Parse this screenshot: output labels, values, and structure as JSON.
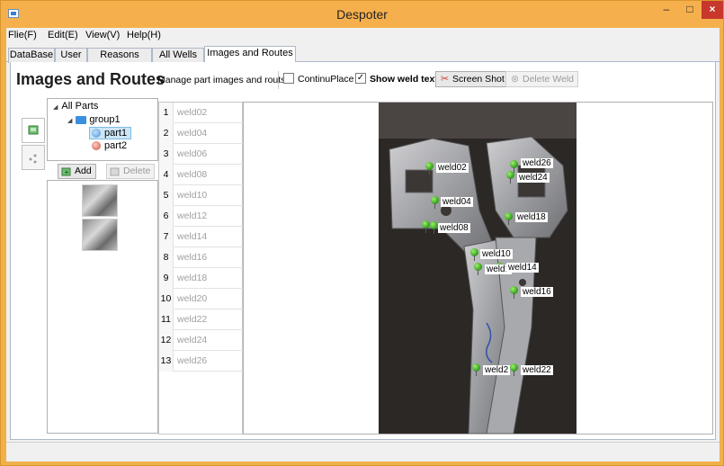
{
  "window": {
    "title": "Despoter",
    "minimize_glyph": "–",
    "maximize_glyph": "□",
    "close_glyph": "×",
    "frame_color": "#f5b04d"
  },
  "menu": {
    "file": "Flie(F)",
    "edit": "Edit(E)",
    "view": "View(V)",
    "help": "Help(H)"
  },
  "tabs": [
    {
      "label": "DataBase"
    },
    {
      "label": "User"
    },
    {
      "label": "Reasons"
    },
    {
      "label": "All Wells"
    },
    {
      "label": "Images and Routes",
      "active": true
    }
  ],
  "toolbar": {
    "title": "Images and Routes",
    "subtitle": "Manage part images and routs",
    "continu_place_label": "ContinuPlace",
    "continu_place_checked": false,
    "show_weld_text_label": "Show weld text",
    "show_weld_text_checked": true,
    "check_glyph": "✓",
    "screenshot_label": "Screen Shot",
    "delete_weld_label": "Delete Weld"
  },
  "tree": {
    "root": "All Parts",
    "group": "group1",
    "parts": [
      "part1",
      "part2"
    ],
    "selected": "part1"
  },
  "part_buttons": {
    "add": "Add",
    "delete": "Delete"
  },
  "weld_list": [
    {
      "num": "1",
      "name": "weld02"
    },
    {
      "num": "2",
      "name": "weld04"
    },
    {
      "num": "3",
      "name": "weld06"
    },
    {
      "num": "4",
      "name": "weld08"
    },
    {
      "num": "5",
      "name": "weld10"
    },
    {
      "num": "6",
      "name": "weld12"
    },
    {
      "num": "7",
      "name": "weld14"
    },
    {
      "num": "8",
      "name": "weld16"
    },
    {
      "num": "9",
      "name": "weld18"
    },
    {
      "num": "10",
      "name": "weld20"
    },
    {
      "num": "11",
      "name": "weld22"
    },
    {
      "num": "12",
      "name": "weld24"
    },
    {
      "num": "13",
      "name": "weld26"
    }
  ],
  "image_welds": {
    "weld02": "weld02",
    "weld04": "weld04",
    "weld08": "weld08",
    "weld10": "weld10",
    "weld12_partial": "weld1",
    "weld14": "weld14",
    "weld16": "weld16",
    "weld18": "weld18",
    "weld20_partial": "weld2",
    "weld22": "weld22",
    "weld24": "weld24",
    "weld26": "weld26"
  }
}
